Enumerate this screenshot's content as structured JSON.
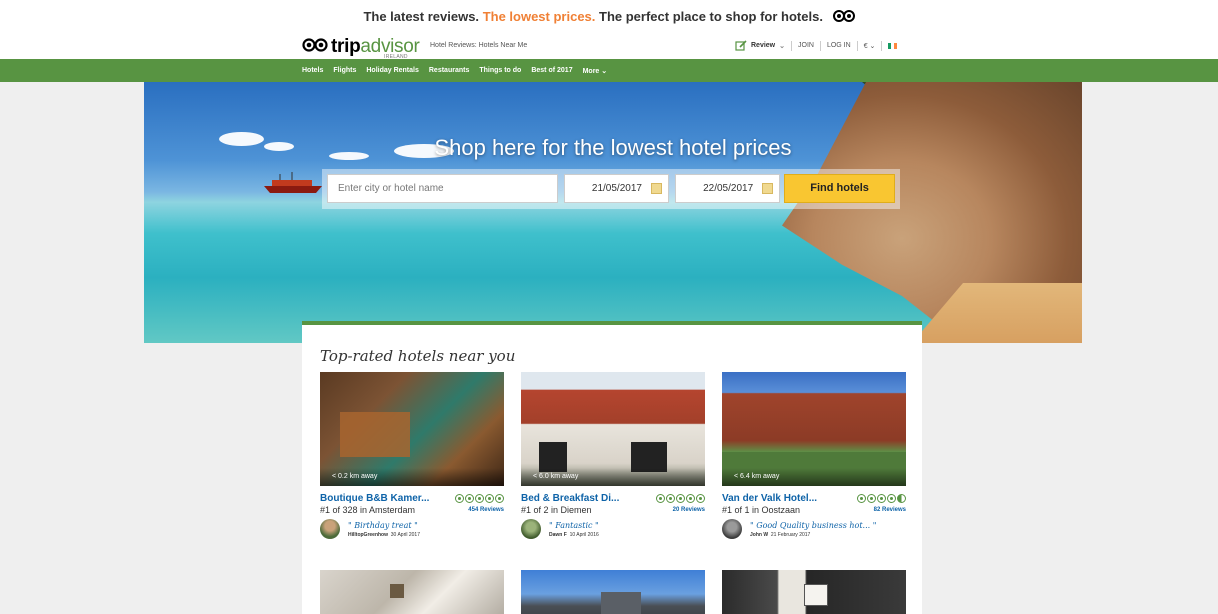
{
  "promo": {
    "part1": "The latest reviews.",
    "part2": "The lowest prices.",
    "part3": "The perfect place to shop for hotels."
  },
  "header": {
    "logo_trip": "trip",
    "logo_advisor": "advisor",
    "logo_country": "IRELAND",
    "subhead": "Hotel Reviews: Hotels Near Me",
    "review_label": "Review",
    "join": "JOIN",
    "login": "LOG IN",
    "currency": "€"
  },
  "nav": [
    "Hotels",
    "Flights",
    "Holiday Rentals",
    "Restaurants",
    "Things to do",
    "Best of 2017",
    "More"
  ],
  "hero": {
    "title": "Shop here for the lowest hotel prices",
    "city_placeholder": "Enter city or hotel name",
    "checkin": "21/05/2017",
    "checkout": "22/05/2017",
    "find_button": "Find hotels"
  },
  "section_title": "Top-rated hotels near you",
  "hotels": [
    {
      "distance": "< 0.2 km away",
      "name": "Boutique B&B Kamer...",
      "rank": "#1 of 328 in Amsterdam",
      "reviews": "454 Reviews",
      "rating": 5,
      "quote": "\" Birthday treat \"",
      "author": "HilltopGreenhow",
      "date": "30 April 2017"
    },
    {
      "distance": "< 6.0 km away",
      "name": "Bed & Breakfast Di...",
      "rank": "#1 of 2 in Diemen",
      "reviews": "20 Reviews",
      "rating": 5,
      "quote": "\" Fantastic \"",
      "author": "Dawn F",
      "date": "10 April 2016"
    },
    {
      "distance": "< 6.4 km away",
      "name": "Van der Valk Hotel...",
      "rank": "#1 of 1 in Oostzaan",
      "reviews": "82 Reviews",
      "rating": 4.5,
      "quote": "\" Good Quality business hot... \"",
      "author": "John W",
      "date": "21 February 2017"
    }
  ],
  "colors": {
    "brand_green": "#589442",
    "link_blue": "#0e63a8",
    "accent_orange": "#f08035",
    "button_yellow": "#f9c631"
  }
}
